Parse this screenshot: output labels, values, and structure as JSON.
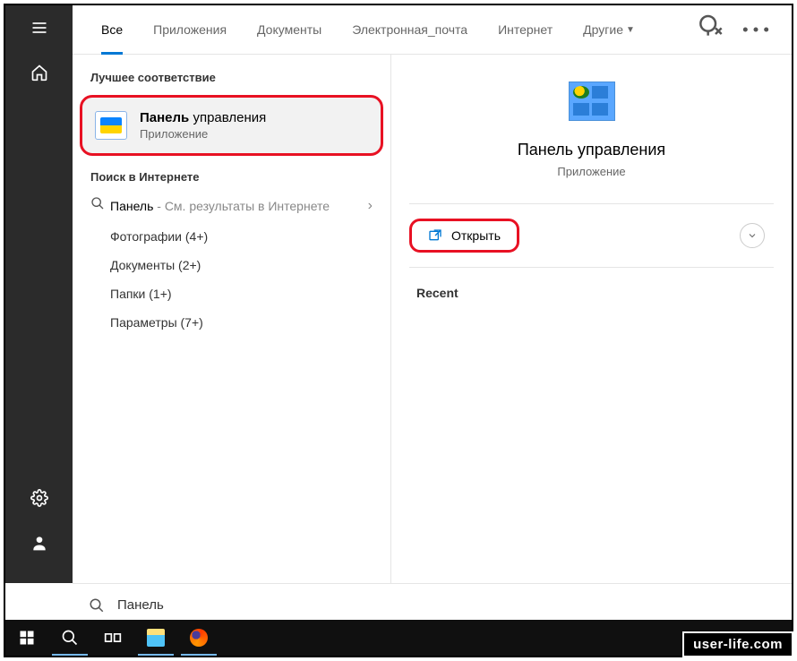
{
  "sidebar": {
    "top": [
      "menu",
      "home"
    ],
    "bottom": [
      "settings",
      "account"
    ]
  },
  "tabs": {
    "items": [
      {
        "label": "Все",
        "active": true
      },
      {
        "label": "Приложения",
        "active": false
      },
      {
        "label": "Документы",
        "active": false
      },
      {
        "label": "Электронная_почта",
        "active": false
      },
      {
        "label": "Интернет",
        "active": false
      },
      {
        "label": "Другие",
        "active": false,
        "dropdown": true
      }
    ]
  },
  "left": {
    "best_match_header": "Лучшее соответствие",
    "best_match": {
      "title_bold": "Панель",
      "title_rest": " управления",
      "subtitle": "Приложение"
    },
    "web_header": "Поиск в Интернете",
    "web_search": {
      "query": "Панель",
      "hint": " - См. результаты в Интернете"
    },
    "results": [
      "Фотографии (4+)",
      "Документы (2+)",
      "Папки (1+)",
      "Параметры (7+)"
    ]
  },
  "right": {
    "title": "Панель управления",
    "subtitle": "Приложение",
    "open_label": "Открыть",
    "recent_header": "Recent"
  },
  "search": {
    "value": "Панель"
  },
  "watermark": "user-life.com"
}
